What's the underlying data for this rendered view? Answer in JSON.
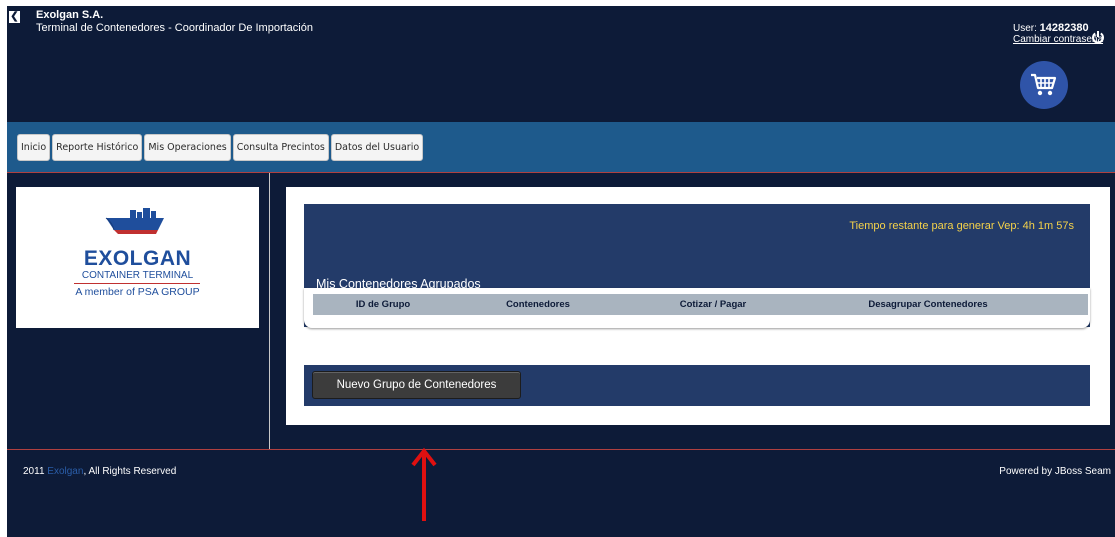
{
  "header": {
    "company": "Exolgan S.A.",
    "subtitle": "Terminal de Contenedores - Coordinador De Importación",
    "user_prefix": "User: ",
    "user_id": "14282380",
    "change_password": "Cambiar contraseña",
    "icons": {
      "back": "back-chevron-icon",
      "power": "power-icon",
      "cart": "shopping-cart-icon"
    }
  },
  "nav": {
    "tabs": [
      {
        "label": "Inicio"
      },
      {
        "label": "Reporte Histórico"
      },
      {
        "label": "Mis Operaciones"
      },
      {
        "label": "Consulta Precintos"
      },
      {
        "label": "Datos del Usuario"
      }
    ]
  },
  "logo": {
    "name": "EXOLGAN",
    "line2": "CONTAINER TERMINAL",
    "line3": "A member of PSA GROUP",
    "icon": "ship-icon"
  },
  "main": {
    "timer": "Tiempo restante para generar Vep: 4h 1m 57s",
    "section_title": "Mis Contenedores Agrupados",
    "table_headers": [
      "ID de Grupo",
      "Contenedores",
      "Cotizar / Pagar",
      "Desagrupar Contenedores"
    ],
    "new_group_button": "Nuevo Grupo de Contenedores"
  },
  "footer": {
    "year": "2011 ",
    "brand": "Exolgan",
    "rights": ", All Rights Reserved",
    "powered": "Powered by JBoss Seam"
  },
  "colors": {
    "background": "#0d1b38",
    "navbar": "#1e5a8c",
    "panel": "#233b69",
    "timer": "#f5d24a",
    "annotation_arrow": "#e01010"
  }
}
